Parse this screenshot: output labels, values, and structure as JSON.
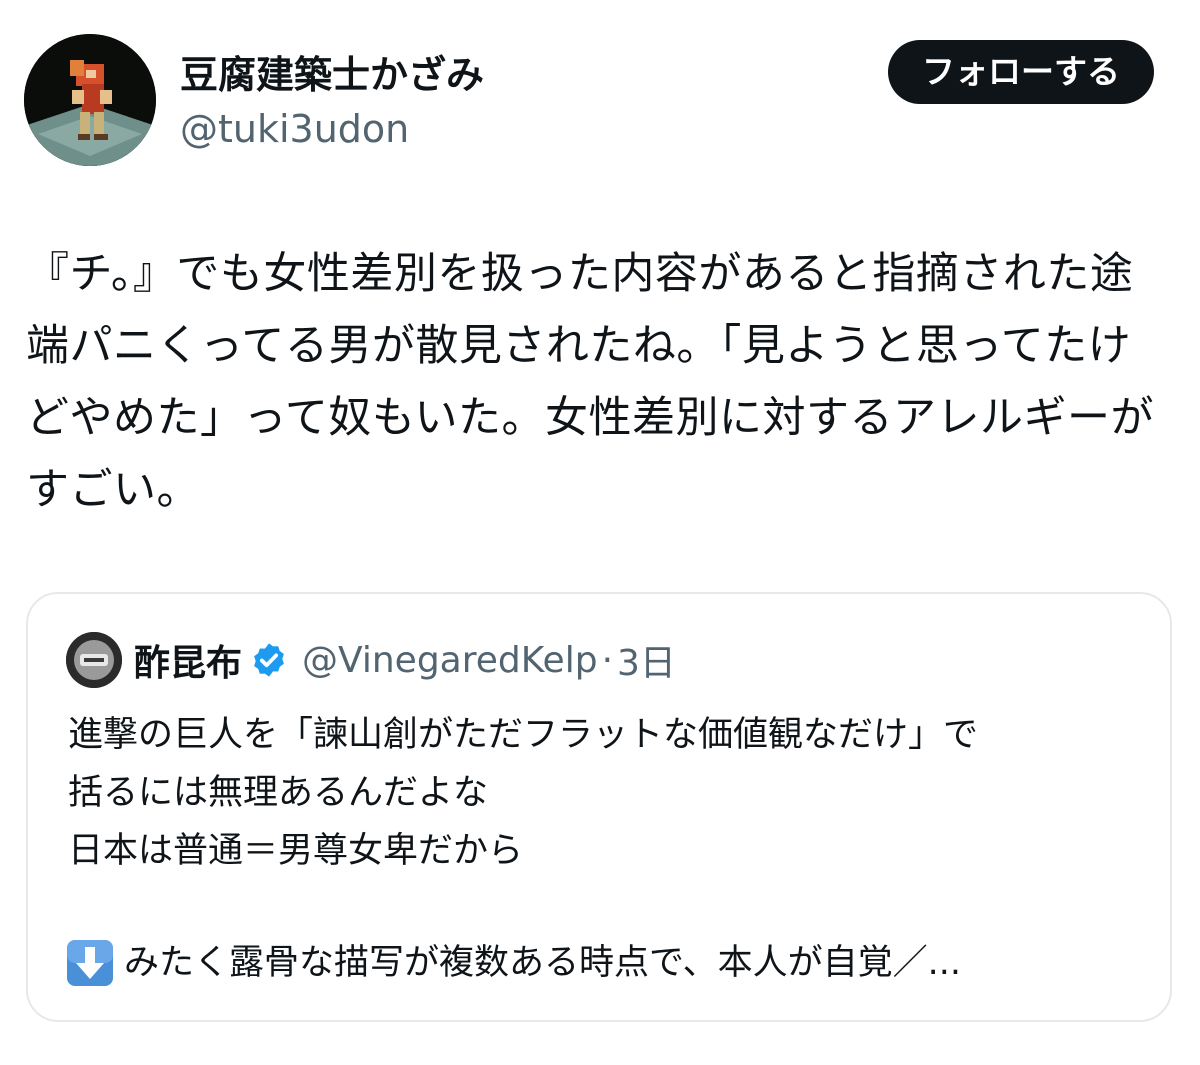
{
  "author": {
    "display_name": "豆腐建築士かざみ",
    "handle": "@tuki3udon",
    "avatar_icon": "pixel-character-avatar"
  },
  "follow_button": {
    "label": "フォローする"
  },
  "tweet": {
    "text": "『チ。』でも女性差別を扱った内容があると指摘された途端パニくってる男が散見されたね。「見ようと思ってたけどやめた」って奴もいた。女性差別に対するアレルギーがすごい。"
  },
  "quoted_tweet": {
    "display_name": "酢昆布",
    "verified_icon": "verified-badge-icon",
    "handle": "@VinegaredKelp",
    "separator": "·",
    "time": "3日",
    "text": "進撃の巨人を「諫山創がただフラットな価値観なだけ」で\n括るには無理あるんだよな\n日本は普通＝男尊女卑だから",
    "last_line_icon": "down-arrow-icon",
    "last_line": "みたく露骨な描写が複数ある時点で、本人が自覚／..."
  },
  "colors": {
    "text": "#0f1419",
    "secondary": "#536471",
    "button_bg": "#0f1419",
    "verified": "#1d9bf0",
    "border": "#e6e8ea"
  }
}
